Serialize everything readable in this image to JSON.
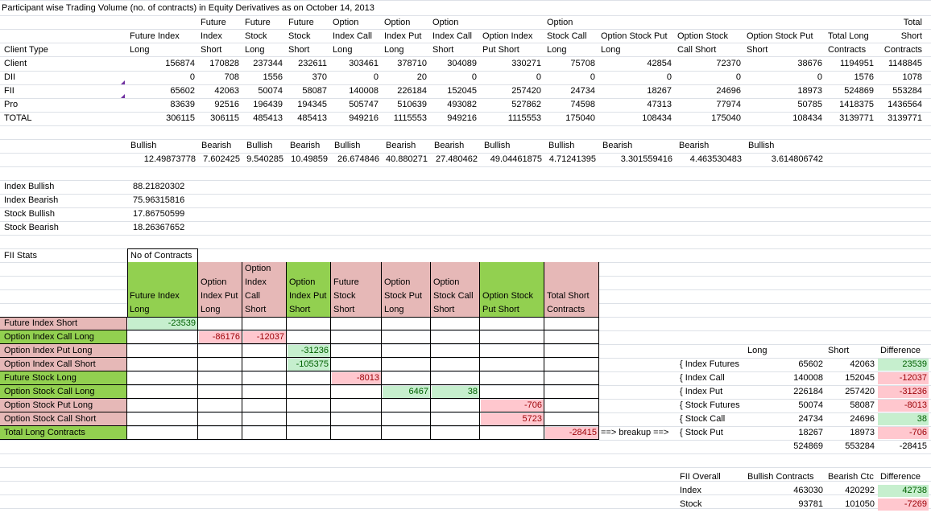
{
  "sheet": {
    "title": "Participant wise Trading Volume (no. of contracts) in Equity Derivatives as on October 14, 2013",
    "header": {
      "client_type": "Client Type",
      "cols": [
        "Future Index\nLong",
        "Future\nIndex\nShort",
        "Future\nStock\nLong",
        "Future\nStock\nShort",
        "Option\nIndex Call\nLong",
        "Option\nIndex Put\nLong",
        "Option\nIndex Call\nShort",
        "Option Index\nPut Short",
        "Option\nStock Call\nLong",
        "Option Stock Put\nLong",
        "Option Stock\nCall Short",
        "Option Stock Put\nShort",
        "Total Long\nContracts",
        "Total\nShort\nContracts"
      ]
    },
    "rows": [
      {
        "label": "Client",
        "values": [
          "156874",
          "170828",
          "237344",
          "232611",
          "303461",
          "378710",
          "304089",
          "330271",
          "75708",
          "42854",
          "72370",
          "38676",
          "1194951",
          "1148845"
        ]
      },
      {
        "label": "DII",
        "values": [
          "0",
          "708",
          "1556",
          "370",
          "0",
          "20",
          "0",
          "0",
          "0",
          "0",
          "0",
          "0",
          "1576",
          "1078"
        ]
      },
      {
        "label": "FII",
        "values": [
          "65602",
          "42063",
          "50074",
          "58087",
          "140008",
          "226184",
          "152045",
          "257420",
          "24734",
          "18267",
          "24696",
          "18973",
          "524869",
          "553284"
        ]
      },
      {
        "label": "Pro",
        "values": [
          "83639",
          "92516",
          "196439",
          "194345",
          "505747",
          "510639",
          "493082",
          "527862",
          "74598",
          "47313",
          "77974",
          "50785",
          "1418375",
          "1436564"
        ]
      },
      {
        "label": "TOTAL",
        "values": [
          "306115",
          "306115",
          "485413",
          "485413",
          "949216",
          "1115553",
          "949216",
          "1115553",
          "175040",
          "108434",
          "175040",
          "108434",
          "3139771",
          "3139771"
        ]
      }
    ],
    "sentiment_labels": [
      "Bullish",
      "Bearish",
      "Bullish",
      "Bearish",
      "Bullish",
      "Bearish",
      "Bearish",
      "Bullish",
      "Bullish",
      "Bearish",
      "Bearish",
      "Bullish"
    ],
    "sentiment_values": [
      "12.49873778",
      "7.602425",
      "9.540285",
      "10.49859",
      "26.674846",
      "40.880271",
      "27.480462",
      "49.04461875",
      "4.71241395",
      "3.301559416",
      "4.463530483",
      "3.614806742"
    ],
    "summary": [
      {
        "label": "Index Bullish",
        "value": "88.21820302"
      },
      {
        "label": "Index Bearish",
        "value": "75.96315816"
      },
      {
        "label": "Stock Bullish",
        "value": "17.86750599"
      },
      {
        "label": "Stock Bearish",
        "value": "18.26367652"
      }
    ],
    "fii_stats": {
      "label": "FII Stats",
      "corner": "No of Contracts",
      "col_headers": [
        "Future Index\nLong",
        "Option\nIndex Put\nLong",
        "Option\nIndex\nCall\nShort",
        "Option\nIndex Put\nShort",
        "Future\nStock\nShort",
        "Option\nStock Put\nLong",
        "Option\nStock Call\nShort",
        "Option Stock\nPut Short",
        "Total Short\nContracts"
      ],
      "row_headers": [
        "Future Index Short",
        "Option Index Call Long",
        "Option Index Put Long",
        "Option Index Call Short",
        "Future Stock Long",
        "Option Stock Call Long",
        "Option Stock Put Long",
        "Option Stock Call Short",
        "Total Long Contracts"
      ],
      "cells": [
        {
          "row": 0,
          "col": 0,
          "value": "-23539"
        },
        {
          "row": 1,
          "col": 1,
          "value": "-86176"
        },
        {
          "row": 1,
          "col": 2,
          "value": "-12037"
        },
        {
          "row": 2,
          "col": 3,
          "value": "-31236"
        },
        {
          "row": 3,
          "col": 3,
          "value": "-105375"
        },
        {
          "row": 4,
          "col": 4,
          "value": "-8013"
        },
        {
          "row": 5,
          "col": 5,
          "value": "6467"
        },
        {
          "row": 5,
          "col": 6,
          "value": "38"
        },
        {
          "row": 6,
          "col": 7,
          "value": "-706"
        },
        {
          "row": 7,
          "col": 7,
          "value": "5723"
        },
        {
          "row": 8,
          "col": 8,
          "value": "-28415"
        }
      ],
      "breakup_arrow": "==> breakup ==>"
    },
    "breakup": {
      "headers": [
        "Long",
        "Short",
        "Difference"
      ],
      "rows": [
        {
          "label": "{ Index Futures",
          "long": "65602",
          "short": "42063",
          "diff": "23539"
        },
        {
          "label": "{ Index Call",
          "long": "140008",
          "short": "152045",
          "diff": "-12037"
        },
        {
          "label": "{ Index Put",
          "long": "226184",
          "short": "257420",
          "diff": "-31236"
        },
        {
          "label": "{ Stock Futures",
          "long": "50074",
          "short": "58087",
          "diff": "-8013"
        },
        {
          "label": "{ Stock Call",
          "long": "24734",
          "short": "24696",
          "diff": "38"
        },
        {
          "label": "{ Stock Put",
          "long": "18267",
          "short": "18973",
          "diff": "-706"
        }
      ],
      "totals": {
        "long": "524869",
        "short": "553284",
        "diff": "-28415"
      }
    },
    "fii_overall": {
      "label": "FII Overall",
      "headers": [
        "Bullish Contracts",
        "Bearish Ctc",
        "Difference"
      ],
      "rows": [
        {
          "label": "Index",
          "bull": "463030",
          "bear": "420292",
          "diff": "42738"
        },
        {
          "label": "Stock",
          "bull": "93781",
          "bear": "101050",
          "diff": "-7269"
        }
      ]
    },
    "colors": {
      "green": "#92d050",
      "pink": "#e6b8b7",
      "positive_bg": "#c6efce",
      "negative_bg": "#ffc7ce",
      "gridline": "#dde1e7"
    }
  }
}
